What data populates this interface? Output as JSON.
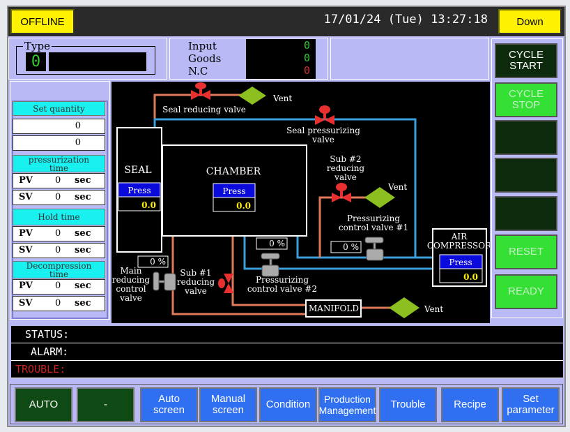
{
  "header": {
    "mode": "OFFLINE",
    "datetime": "17/01/24 (Tue) 13:27:18",
    "state": "Down"
  },
  "type_panel": {
    "label": "Type",
    "value": "0",
    "name": ""
  },
  "counts": {
    "input_label": "Input",
    "goods_label": "Goods",
    "nc_label": "N.C",
    "input": "0",
    "goods": "0",
    "nc": "0"
  },
  "left_panel": {
    "set_quantity": {
      "title": "Set quantity",
      "values": [
        "0",
        "0"
      ]
    },
    "pressurization": {
      "title1": "pressurization",
      "title2": "time",
      "pv": "0",
      "sv": "0"
    },
    "hold": {
      "title1": "Hold time",
      "pv": "0",
      "sv": "0"
    },
    "decompression": {
      "title1": "Decompression",
      "title2": "time",
      "pv": "0",
      "sv": "0"
    },
    "pv_label": "PV",
    "sv_label": "SV",
    "unit": "sec"
  },
  "diagram": {
    "seal": {
      "label": "SEAL",
      "press_label": "Press",
      "value": "0.0"
    },
    "chamber": {
      "label": "CHAMBER",
      "press_label": "Press",
      "value": "0.0"
    },
    "air_compressor": {
      "label1": "AIR",
      "label2": "COMPRESSOR",
      "press_label": "Press",
      "value": "0.0"
    },
    "manifold": "MANIFOLD",
    "vent": "Vent",
    "seal_reducing_valve": "Seal reducing valve",
    "seal_pressurizing_valve": [
      "Seal pressurizing",
      "valve"
    ],
    "sub2_reducing_valve": [
      "Sub #2",
      "reducing",
      "valve"
    ],
    "pressurizing_control_valve_1": {
      "label": [
        "Pressurizing",
        "control valve #1"
      ],
      "open": "0 %"
    },
    "pressurizing_control_valve_2": {
      "label": [
        "Pressurizing",
        "control valve #2"
      ],
      "open": "0 %"
    },
    "main_reducing_control_valve": {
      "label": [
        "Main",
        "reducing",
        "control",
        "valve"
      ],
      "open": "0 %"
    },
    "sub1_reducing_valve": [
      "Sub #1",
      "reducing",
      "valve"
    ],
    "colors": {
      "air_line": "#3aa0dc",
      "vent_line": "#e07a5a",
      "vent": "#8cc020",
      "valve": "#e83030"
    }
  },
  "right_buttons": [
    {
      "label": "CYCLE\nSTART"
    },
    {
      "label": "CYCLE\nSTOP"
    },
    {
      "label": ""
    },
    {
      "label": ""
    },
    {
      "label": ""
    },
    {
      "label": "RESET"
    },
    {
      "label": "READY"
    }
  ],
  "status": {
    "status": "STATUS:",
    "alarm": "ALARM:",
    "trouble": "TROUBLE:"
  },
  "bottom_buttons": [
    "AUTO",
    "-",
    "Auto\nscreen",
    "Manual\nscreen",
    "Condition",
    "Production\nManagement",
    "Trouble",
    "Recipe",
    "Set\nparameter"
  ]
}
